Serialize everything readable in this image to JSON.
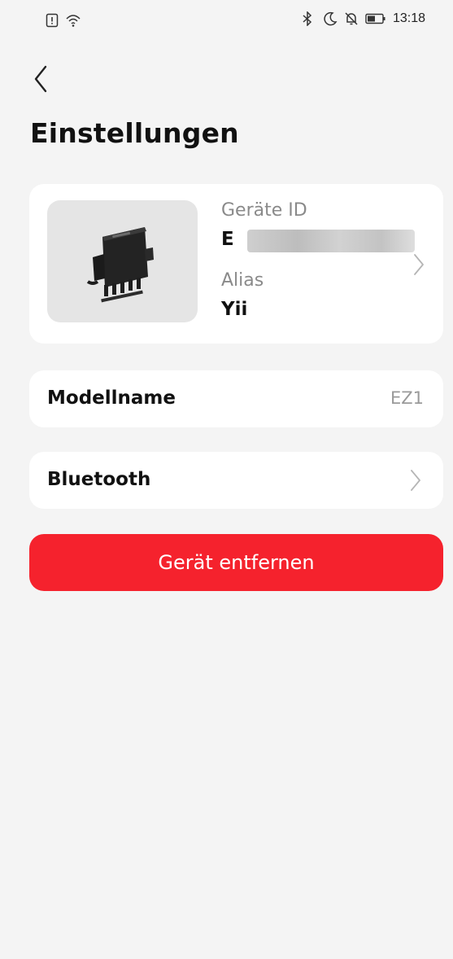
{
  "status_bar": {
    "time": "13:18",
    "left_icons": [
      "sim-alert-icon",
      "wifi-icon"
    ],
    "right_icons": [
      "bluetooth-icon",
      "moon-icon",
      "bell-off-icon",
      "battery-icon"
    ]
  },
  "header": {
    "back_icon": "chevron-left-icon",
    "title": "Einstellungen"
  },
  "device_card": {
    "device_id_label": "Geräte ID",
    "device_id_value": "E",
    "alias_label": "Alias",
    "alias_value": "Yii",
    "chevron_icon": "chevron-right-icon"
  },
  "settings": {
    "model": {
      "label": "Modellname",
      "value": "EZ1"
    },
    "bluetooth": {
      "label": "Bluetooth",
      "chevron_icon": "chevron-right-icon"
    }
  },
  "actions": {
    "remove_label": "Gerät entfernen"
  },
  "colors": {
    "background": "#f4f4f4",
    "card": "#ffffff",
    "danger": "#f5222d",
    "muted_text": "#8a8a8a"
  }
}
